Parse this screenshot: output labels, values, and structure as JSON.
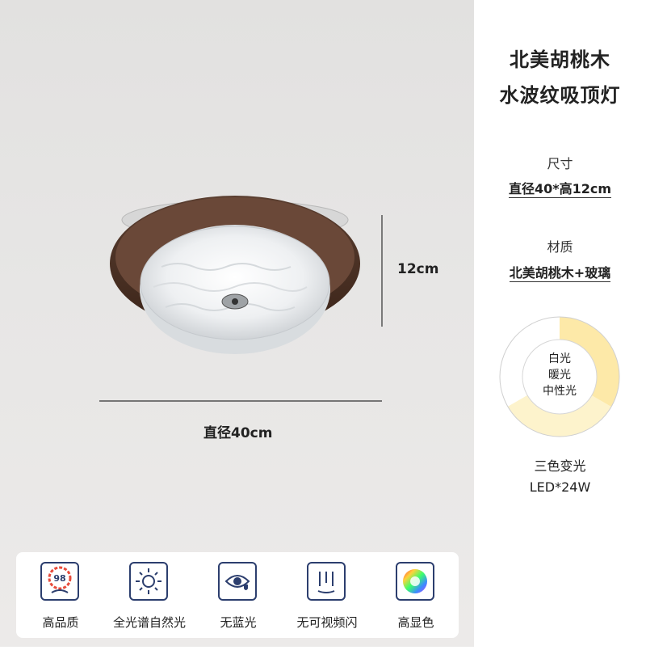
{
  "product": {
    "title_line1": "北美胡桃木",
    "title_line2": "水波纹吸顶灯"
  },
  "specs": {
    "size_label": "尺寸",
    "size_value": "直径40*高12cm",
    "material_label": "材质",
    "material_value": "北美胡桃木+玻璃"
  },
  "dimensions": {
    "height": "12cm",
    "diameter": "直径40cm"
  },
  "light_modes": {
    "items": [
      "白光",
      "暖光",
      "中性光"
    ],
    "caption": "三色变光",
    "power": "LED*24W",
    "colors": {
      "white": "#ffffff",
      "warm": "#fbe5a0",
      "neutral": "#fdf3cc"
    }
  },
  "features": [
    {
      "label": "高品质",
      "icon": "quality-98-icon",
      "badge": "98"
    },
    {
      "label": "全光谱自然光",
      "icon": "sun-icon"
    },
    {
      "label": "无蓝光",
      "icon": "eye-shield-icon"
    },
    {
      "label": "无可视频闪",
      "icon": "flicker-icon"
    },
    {
      "label": "高显色",
      "icon": "color-wheel-icon"
    }
  ]
}
